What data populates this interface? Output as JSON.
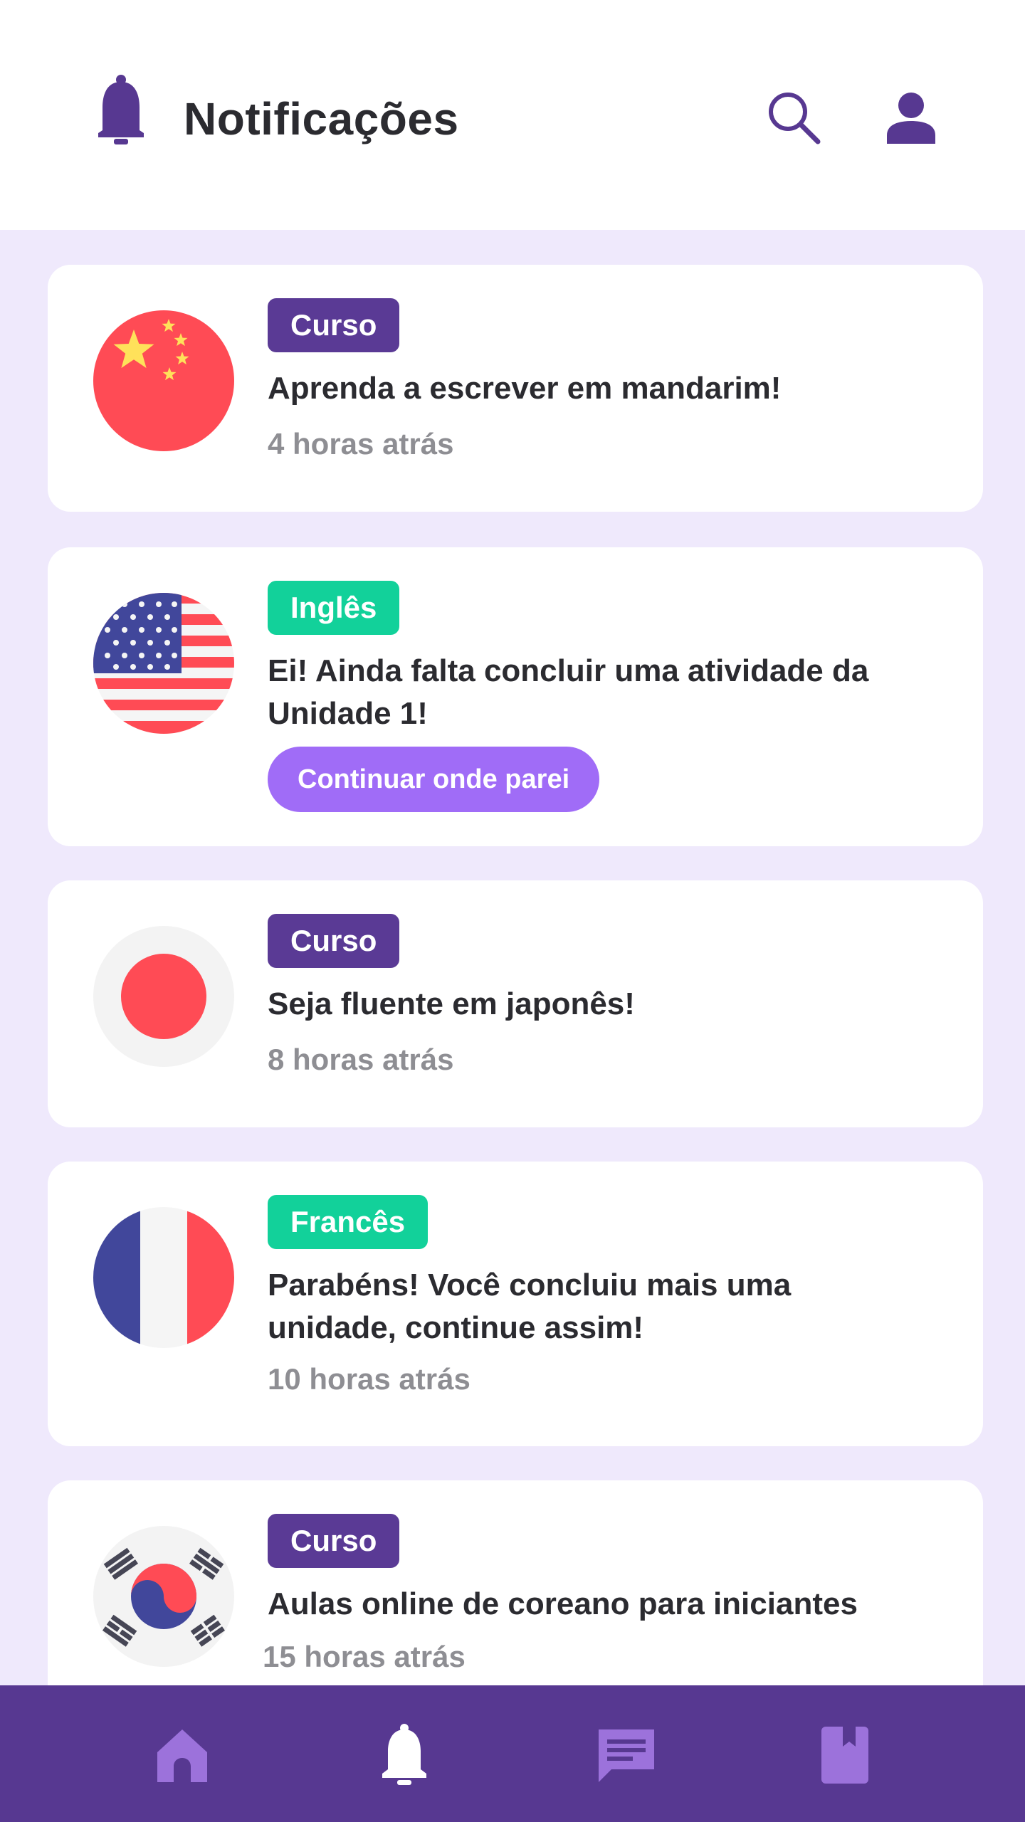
{
  "header": {
    "title": "Notificações",
    "icons": [
      "bell-icon",
      "search-icon",
      "user-icon"
    ]
  },
  "notifications": [
    {
      "flag": "china-flag",
      "tag": "Curso",
      "message": "Aprenda a escrever em mandarim!",
      "time": "4 horas atrás"
    },
    {
      "flag": "usa-flag",
      "tag": "Inglês",
      "message": "Ei! Ainda falta concluir uma atividade da Unidade 1!",
      "action": "Continuar onde parei"
    },
    {
      "flag": "japan-flag",
      "tag": "Curso",
      "message": "Seja fluente em japonês!",
      "time": "8 horas atrás"
    },
    {
      "flag": "france-flag",
      "tag": "Francês",
      "message": "Parabéns! Você concluiu mais uma unidade, continue assim!",
      "time": "10 horas atrás"
    },
    {
      "flag": "korea-flag",
      "tag": "Curso",
      "message": "Aulas online de coreano para iniciantes",
      "time": "15 horas atrás"
    }
  ],
  "bottom_nav": {
    "items": [
      "home-icon",
      "bell-icon",
      "chat-icon",
      "book-icon"
    ],
    "active": "bell-icon"
  },
  "colors": {
    "primary": "#573891",
    "badge_course": "#5a3a95",
    "badge_language": "#12d19a",
    "button": "#a06cf7",
    "background": "#efe9fc",
    "muted_text": "#8e8e93"
  }
}
